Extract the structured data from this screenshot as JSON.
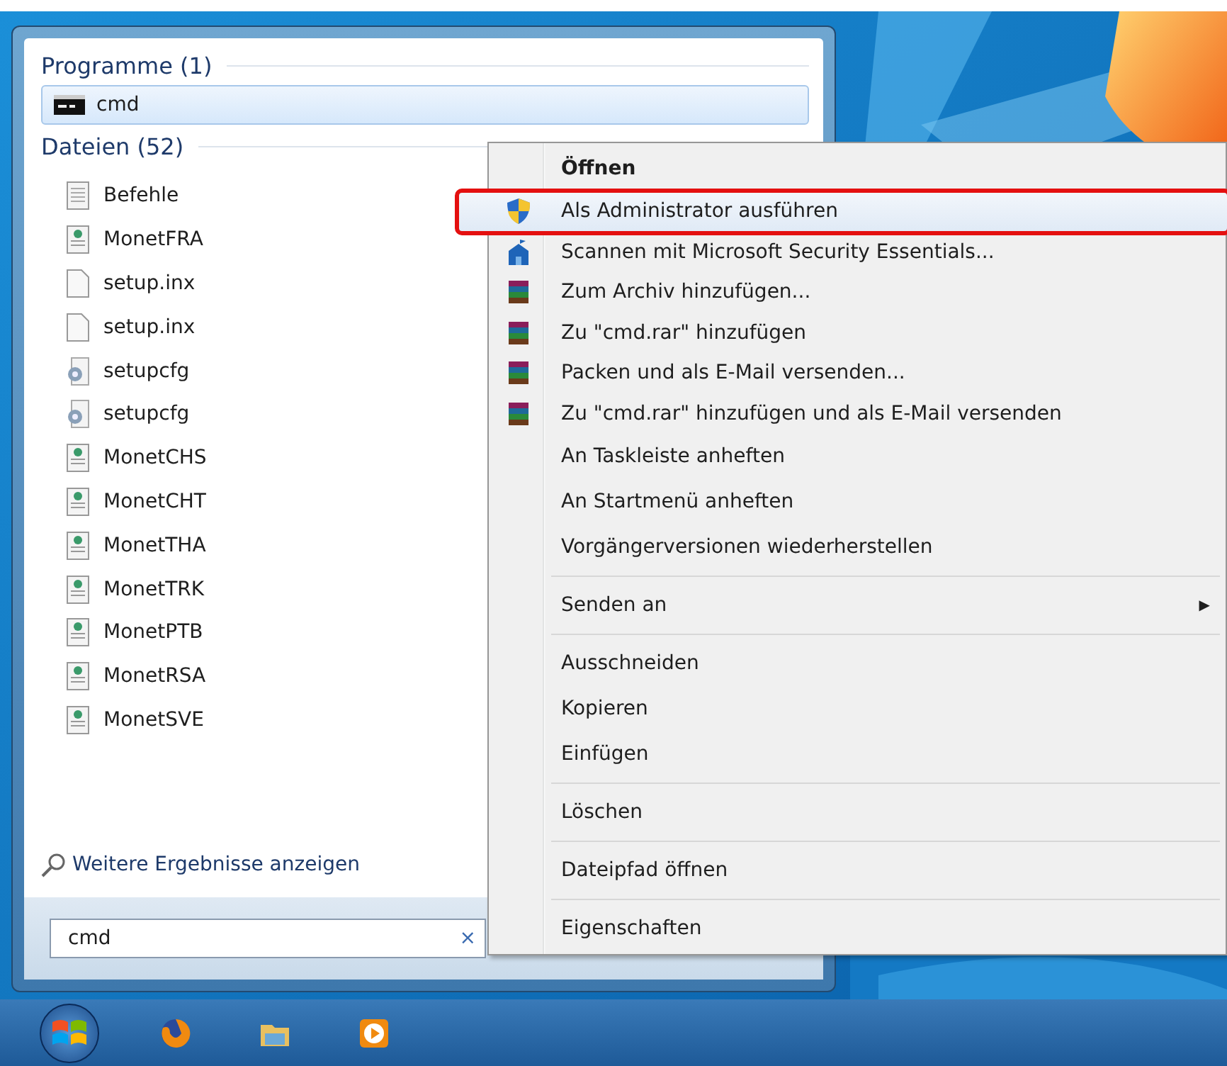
{
  "start_menu": {
    "programs_header": "Programme (1)",
    "programs": [
      {
        "label": "cmd",
        "selected": true
      }
    ],
    "files_header": "Dateien (52)",
    "files": [
      {
        "label": "Befehle",
        "kind": "text"
      },
      {
        "label": "MonetFRA",
        "kind": "web"
      },
      {
        "label": "setup.inx",
        "kind": "blank"
      },
      {
        "label": "setup.inx",
        "kind": "blank"
      },
      {
        "label": "setupcfg",
        "kind": "gear"
      },
      {
        "label": "setupcfg",
        "kind": "gear"
      },
      {
        "label": "MonetCHS",
        "kind": "web"
      },
      {
        "label": "MonetCHT",
        "kind": "web"
      },
      {
        "label": "MonetTHA",
        "kind": "web"
      },
      {
        "label": "MonetTRK",
        "kind": "web"
      },
      {
        "label": "MonetPTB",
        "kind": "web"
      },
      {
        "label": "MonetRSA",
        "kind": "web"
      },
      {
        "label": "MonetSVE",
        "kind": "web"
      }
    ],
    "more_results": "Weitere Ergebnisse anzeigen",
    "search": {
      "value": "cmd",
      "clear": "×"
    }
  },
  "context_menu": [
    {
      "kind": "default",
      "label": "Öffnen",
      "selected": false,
      "highlighted": false
    },
    {
      "kind": "shield",
      "label": "Als Administrator ausführen",
      "selected": true,
      "highlighted": true
    },
    {
      "kind": "scan",
      "label": "Scannen mit Microsoft Security Essentials...",
      "selected": false,
      "highlighted": false
    },
    {
      "kind": "archive",
      "label": "Zum Archiv hinzufügen...",
      "selected": false,
      "highlighted": false
    },
    {
      "kind": "archive",
      "label": "Zu \"cmd.rar\" hinzufügen",
      "selected": false,
      "highlighted": false
    },
    {
      "kind": "archive",
      "label": "Packen und als E-Mail versenden...",
      "selected": false,
      "highlighted": false
    },
    {
      "kind": "archive",
      "label": "Zu \"cmd.rar\" hinzufügen und als E-Mail versenden",
      "selected": false,
      "highlighted": false
    },
    {
      "kind": "plain",
      "label": "An Taskleiste anheften",
      "selected": false,
      "highlighted": false
    },
    {
      "kind": "plain",
      "label": "An Startmenü anheften",
      "selected": false,
      "highlighted": false
    },
    {
      "kind": "plain",
      "label": "Vorgängerversionen wiederherstellen",
      "selected": false,
      "highlighted": false
    },
    {
      "kind": "separator"
    },
    {
      "kind": "submenu",
      "label": "Senden an",
      "arrow": "▶",
      "selected": false,
      "highlighted": false
    },
    {
      "kind": "separator"
    },
    {
      "kind": "plain",
      "label": "Ausschneiden",
      "selected": false,
      "highlighted": false
    },
    {
      "kind": "plain",
      "label": "Kopieren",
      "selected": false,
      "highlighted": false
    },
    {
      "kind": "plain",
      "label": "Einfügen",
      "selected": false,
      "highlighted": false
    },
    {
      "kind": "separator"
    },
    {
      "kind": "plain",
      "label": "Löschen",
      "selected": false,
      "highlighted": false
    },
    {
      "kind": "separator"
    },
    {
      "kind": "plain",
      "label": "Dateipfad öffnen",
      "selected": false,
      "highlighted": false
    },
    {
      "kind": "separator"
    },
    {
      "kind": "plain",
      "label": "Eigenschaften",
      "selected": false,
      "highlighted": false
    }
  ],
  "taskbar": [
    {
      "kind": "firefox"
    },
    {
      "kind": "folder"
    },
    {
      "kind": "media"
    }
  ]
}
